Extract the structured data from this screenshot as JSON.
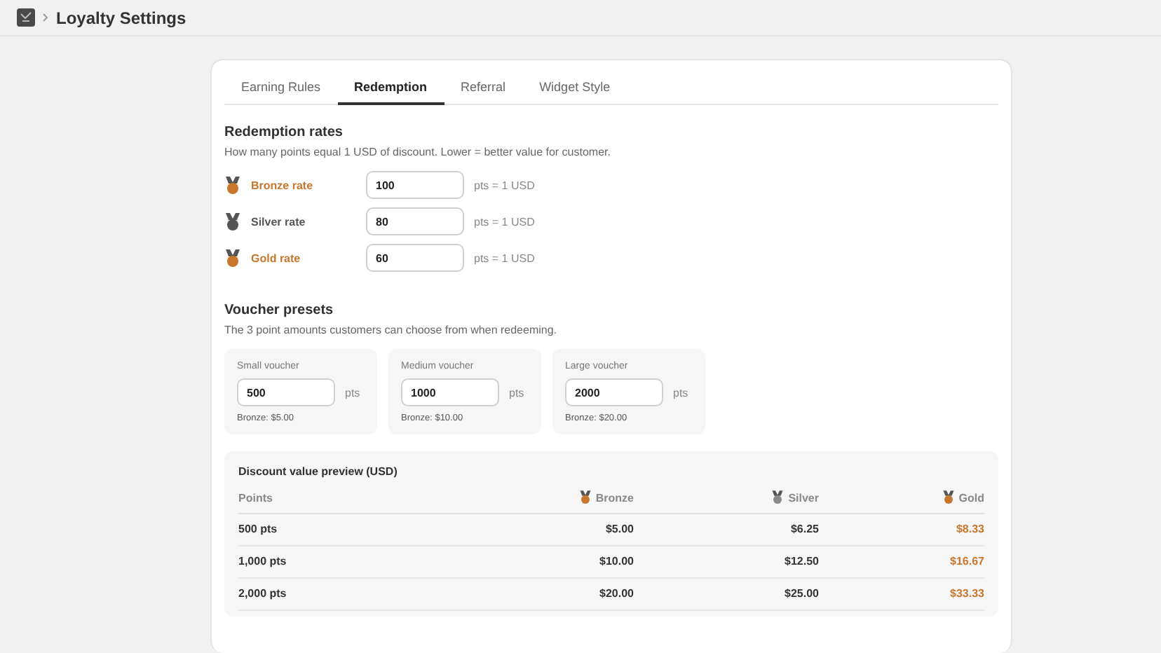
{
  "header": {
    "title": "Loyalty Settings"
  },
  "tabs": [
    {
      "label": "Earning Rules",
      "selected": false
    },
    {
      "label": "Redemption",
      "selected": true
    },
    {
      "label": "Referral",
      "selected": false
    },
    {
      "label": "Widget Style",
      "selected": false
    }
  ],
  "rates": {
    "title": "Redemption rates",
    "description": "How many points equal 1 USD of discount. Lower = better value for customer.",
    "items": [
      {
        "label": "Bronze rate",
        "value": "100",
        "unit": "pts = 1 USD",
        "color": "#c8772c"
      },
      {
        "label": "Silver rate",
        "value": "80",
        "unit": "pts = 1 USD",
        "color": "#555555"
      },
      {
        "label": "Gold rate",
        "value": "60",
        "unit": "pts = 1 USD",
        "color": "#c8772c"
      }
    ]
  },
  "vouchers": {
    "title": "Voucher presets",
    "description": "The 3 point amounts customers can choose from when redeeming.",
    "items": [
      {
        "label": "Small voucher",
        "value": "500",
        "unit": "pts",
        "note": "Bronze: $5.00"
      },
      {
        "label": "Medium voucher",
        "value": "1000",
        "unit": "pts",
        "note": "Bronze: $10.00"
      },
      {
        "label": "Large voucher",
        "value": "2000",
        "unit": "pts",
        "note": "Bronze: $20.00"
      }
    ]
  },
  "preview": {
    "title": "Discount value preview (USD)",
    "columns": [
      {
        "label": "Points",
        "kind": "text",
        "color": "#333333"
      },
      {
        "label": "Bronze",
        "kind": "tier",
        "color": "#333333"
      },
      {
        "label": "Silver",
        "kind": "tier",
        "color": "#333333"
      },
      {
        "label": "Gold",
        "kind": "tier",
        "color": "#c8772c"
      }
    ],
    "rows": [
      [
        "500 pts",
        "$5.00",
        "$6.25",
        "$8.33"
      ],
      [
        "1,000 pts",
        "$10.00",
        "$12.50",
        "$16.67"
      ],
      [
        "2,000 pts",
        "$20.00",
        "$25.00",
        "$33.33"
      ]
    ]
  }
}
